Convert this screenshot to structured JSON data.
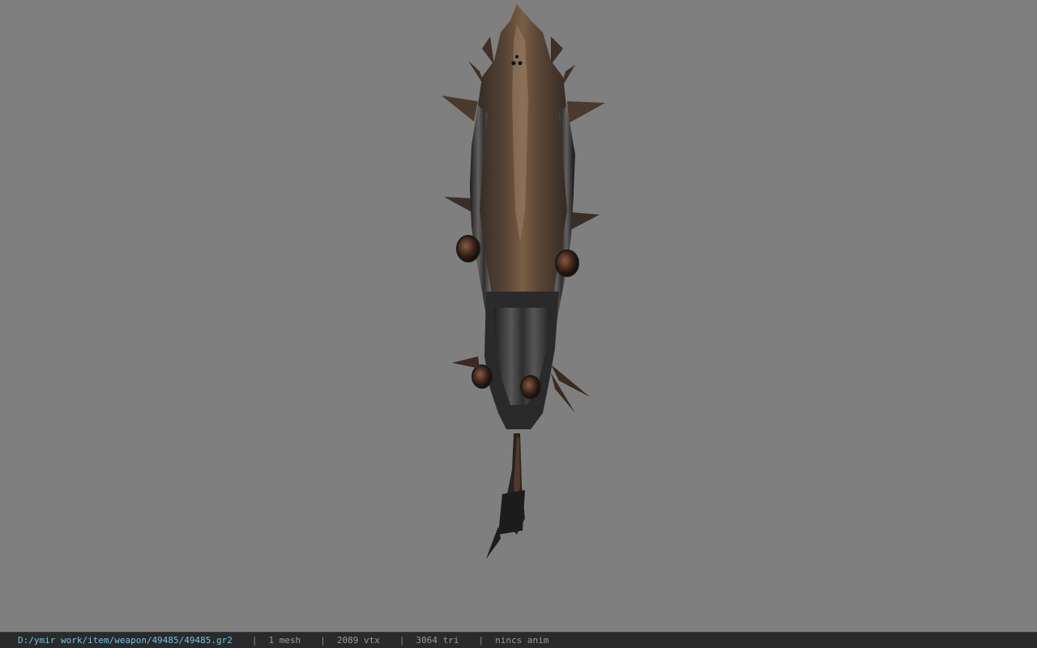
{
  "viewer": {
    "background_color": "#7f7f7f",
    "model_icon": "weapon-model"
  },
  "status_bar": {
    "file_path": "D:/ymir work/item/weapon/49485/49485.gr2",
    "separator": "|",
    "mesh_count": "1 mesh",
    "vertex_count": "2089 vtx",
    "triangle_count": "3064 tri",
    "animation": "nincs anim",
    "path_color": "#6ec3e6"
  }
}
